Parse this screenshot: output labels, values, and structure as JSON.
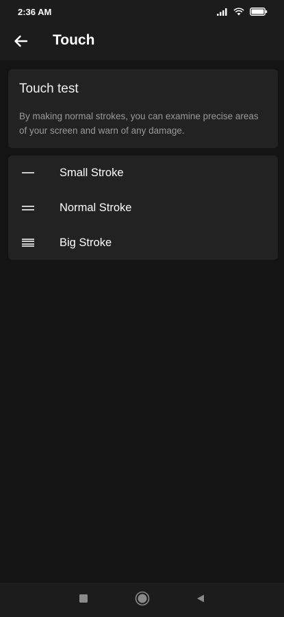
{
  "status_bar": {
    "time": "2:36 AM",
    "icons": [
      "signal-icon",
      "wifi-icon",
      "battery-icon"
    ]
  },
  "app_bar": {
    "back_icon": "arrow-left-icon",
    "title": "Touch"
  },
  "info_card": {
    "title": "Touch test",
    "description": "By making normal strokes, you can examine precise areas of your screen and warn of any damage."
  },
  "stroke_options": [
    {
      "label": "Small Stroke",
      "icon": "small-stroke-icon"
    },
    {
      "label": "Normal Stroke",
      "icon": "normal-stroke-icon"
    },
    {
      "label": "Big Stroke",
      "icon": "big-stroke-icon"
    }
  ],
  "nav_bar": {
    "buttons": [
      "recents-square-icon",
      "home-circle-icon",
      "back-triangle-icon"
    ]
  }
}
